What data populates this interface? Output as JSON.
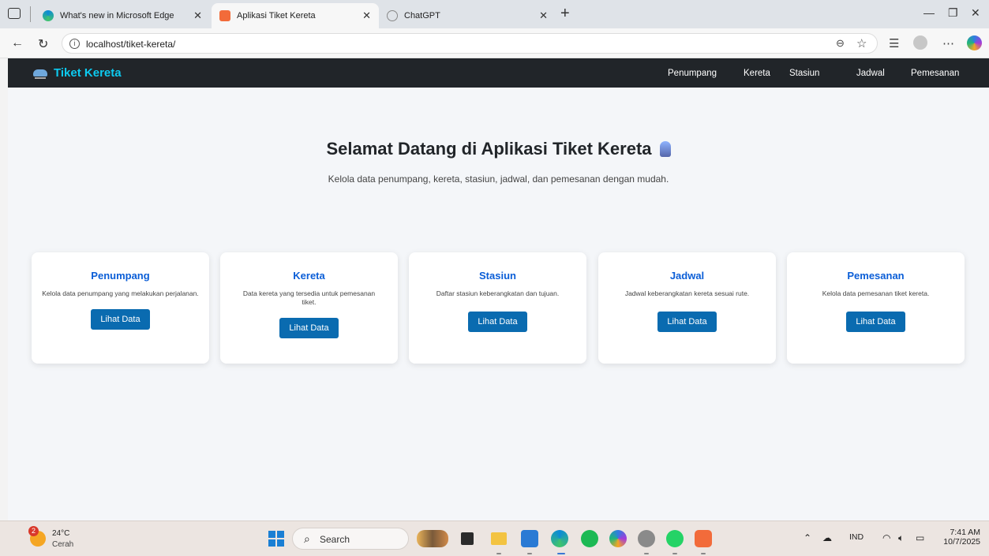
{
  "browser": {
    "tabs": [
      {
        "title": "What's new in Microsoft Edge",
        "active": false
      },
      {
        "title": "Aplikasi Tiket Kereta",
        "active": true
      },
      {
        "title": "ChatGPT",
        "active": false
      }
    ],
    "url": "localhost/tiket-kereta/"
  },
  "app": {
    "brand": "Tiket Kereta",
    "nav": [
      "Penumpang",
      "Kereta",
      "Stasiun",
      "Jadwal",
      "Pemesanan"
    ],
    "hero_title": "Selamat Datang di Aplikasi Tiket Kereta",
    "hero_subtitle": "Kelola data penumpang, kereta, stasiun, jadwal, dan pemesanan dengan mudah.",
    "cards": [
      {
        "title": "Penumpang",
        "desc": "Kelola data penumpang yang melakukan perjalanan.",
        "button": "Lihat Data"
      },
      {
        "title": "Kereta",
        "desc": "Data kereta yang tersedia untuk pemesanan tiket.",
        "button": "Lihat Data"
      },
      {
        "title": "Stasiun",
        "desc": "Daftar stasiun keberangkatan dan tujuan.",
        "button": "Lihat Data"
      },
      {
        "title": "Jadwal",
        "desc": "Jadwal keberangkatan kereta sesuai rute.",
        "button": "Lihat Data"
      },
      {
        "title": "Pemesanan",
        "desc": "Kelola data pemesanan tiket kereta.",
        "button": "Lihat Data"
      }
    ]
  },
  "taskbar": {
    "weather_temp": "24°C",
    "weather_desc": "Cerah",
    "weather_badge": "2",
    "search_placeholder": "Search",
    "language": "IND",
    "time": "7:41 AM",
    "date": "10/7/2025"
  },
  "colors": {
    "navbar_bg": "#212529",
    "brand": "#0dcaf0",
    "card_title": "#0b5ed7",
    "button": "#0a6bb0"
  }
}
